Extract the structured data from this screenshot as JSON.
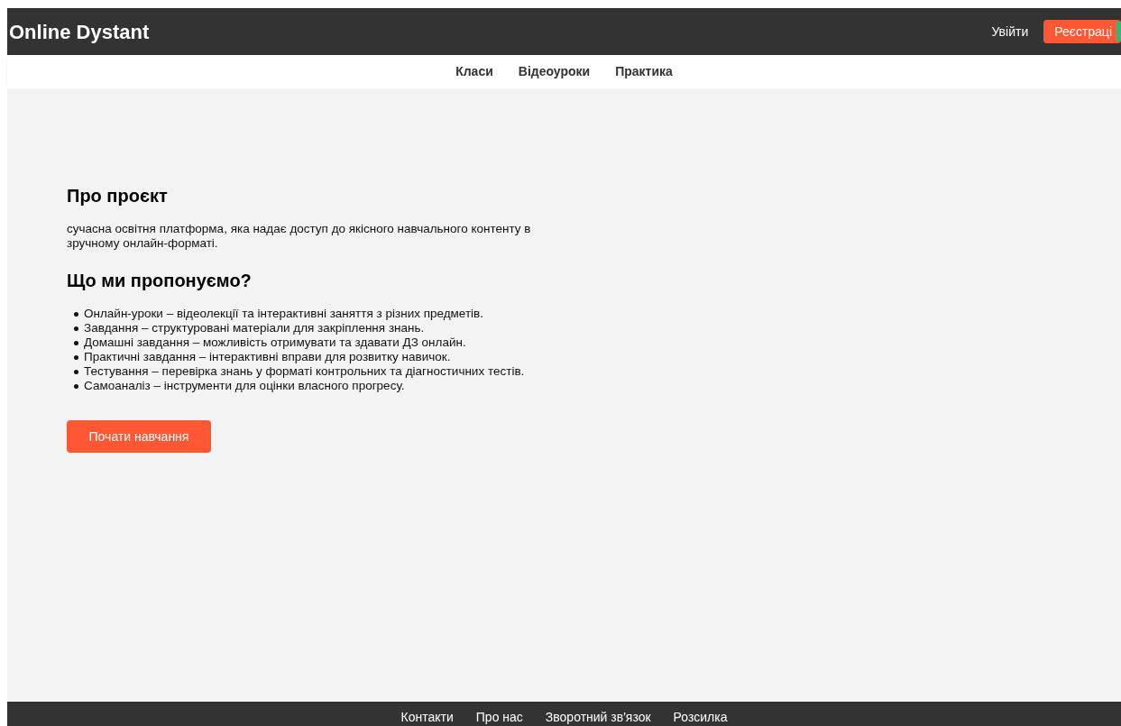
{
  "header": {
    "logo": "Online Dystant",
    "login": "Увійти",
    "register": "Реєстраці"
  },
  "nav": [
    "Класи",
    "Відеоуроки",
    "Практика"
  ],
  "about": {
    "title": "Про проєкт",
    "text": "сучасна освітня платформа, яка надає доступ до якісного навчального контенту в зручному онлайн-форматі."
  },
  "offer": {
    "title": "Що ми пропонуємо?",
    "items": [
      "Онлайн-уроки – відеолекції та інтерактивні заняття з різних предметів.",
      "Завдання – структуровані матеріали для закріплення знань.",
      "Домашні завдання – можливість отримувати та здавати ДЗ онлайн.",
      "Практичні завдання – інтерактивні вправи для розвитку навичок.",
      "Тестування – перевірка знань у форматі контрольних та діагностичних тестів.",
      "Самоаналіз – інструменти для оцінки власного прогресу."
    ]
  },
  "cta": "Почати навчання",
  "footer": [
    "Контакти",
    "Про нас",
    "Зворотний зв'язок",
    "Розсилка"
  ]
}
